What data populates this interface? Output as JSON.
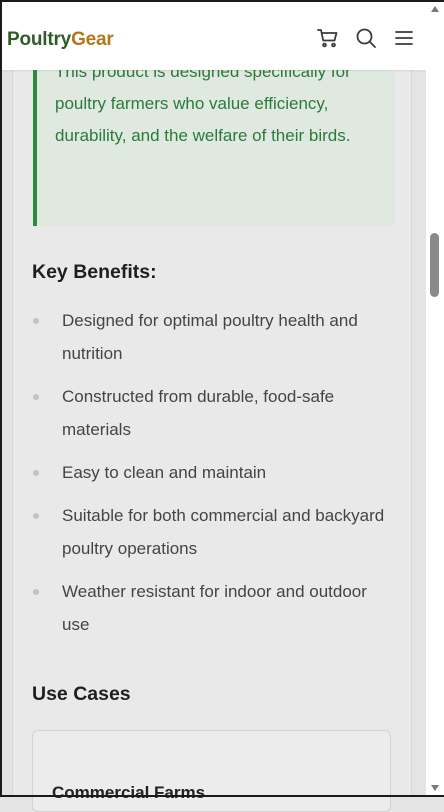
{
  "header": {
    "logo_part1": "Poultry",
    "logo_part2": "Gear",
    "icons": [
      "cart-icon",
      "search-icon",
      "menu-icon"
    ]
  },
  "callout": {
    "text": "This product is designed specifically for poultry farmers who value efficiency, durability, and the welfare of their birds."
  },
  "benefits": {
    "heading": "Key Benefits:",
    "items": [
      "Designed for optimal poultry health and nutrition",
      "Constructed from durable, food-safe materials",
      "Easy to clean and maintain",
      "Suitable for both commercial and backyard poultry operations",
      "Weather resistant for indoor and outdoor use"
    ]
  },
  "use_cases": {
    "heading": "Use Cases",
    "cards": [
      {
        "title": "Commercial Farms"
      }
    ]
  },
  "colors": {
    "logo_green": "#2f5d27",
    "logo_gold": "#b3781a",
    "callout_accent": "#2e8b3e",
    "callout_bg": "#dfe9e0"
  }
}
